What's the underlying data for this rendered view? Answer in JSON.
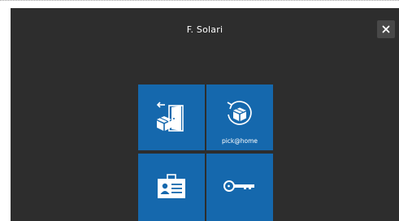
{
  "header": {
    "user_name": "F. Solari"
  },
  "close_button": {
    "icon": "close-icon",
    "glyph": "✕"
  },
  "tiles": [
    {
      "id": "deposit",
      "icon": "package-door-icon",
      "label": ""
    },
    {
      "id": "pickathome",
      "icon": "package-return-icon",
      "label": "pick@home"
    },
    {
      "id": "id-card",
      "icon": "id-card-icon",
      "label": ""
    },
    {
      "id": "key",
      "icon": "key-icon",
      "label": ""
    }
  ],
  "colors": {
    "background": "#2d2d2d",
    "tile": "#1568ad",
    "close_button": "#484848",
    "text": "#ffffff"
  }
}
